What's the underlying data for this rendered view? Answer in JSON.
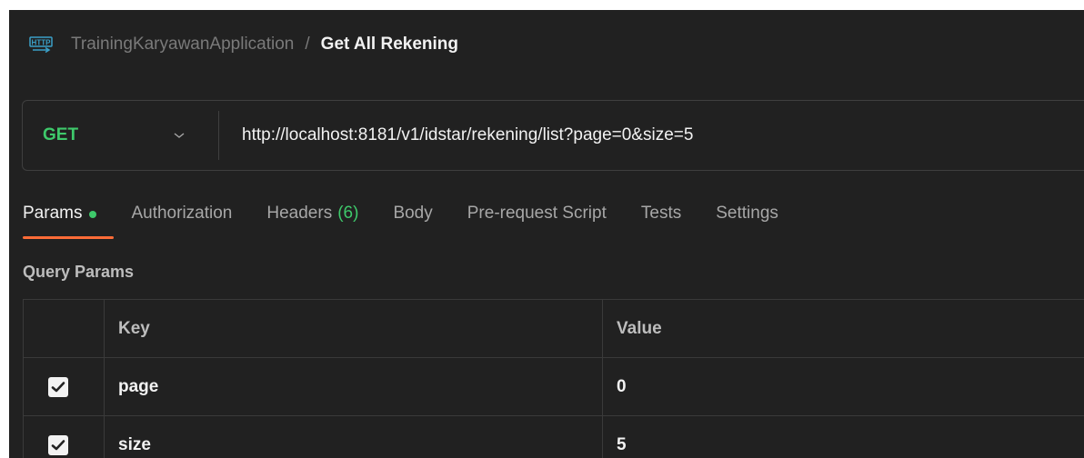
{
  "header": {
    "icon": "http-icon",
    "collection": "TrainingKaryawanApplication",
    "separator": "/",
    "request_name": "Get All Rekening"
  },
  "request": {
    "method": "GET",
    "url": "http://localhost:8181/v1/idstar/rekening/list?page=0&size=5"
  },
  "tabs": [
    {
      "label": "Params",
      "active": true,
      "dot": true
    },
    {
      "label": "Authorization"
    },
    {
      "label": "Headers",
      "count": "(6)"
    },
    {
      "label": "Body"
    },
    {
      "label": "Pre-request Script"
    },
    {
      "label": "Tests"
    },
    {
      "label": "Settings"
    }
  ],
  "query_params": {
    "title": "Query Params",
    "columns": [
      "Key",
      "Value"
    ],
    "rows": [
      {
        "checked": true,
        "key": "page",
        "value": "0"
      },
      {
        "checked": true,
        "key": "size",
        "value": "5"
      }
    ]
  },
  "colors": {
    "background": "#212121",
    "method_get": "#3ec96b",
    "accent": "#ff6c37"
  }
}
